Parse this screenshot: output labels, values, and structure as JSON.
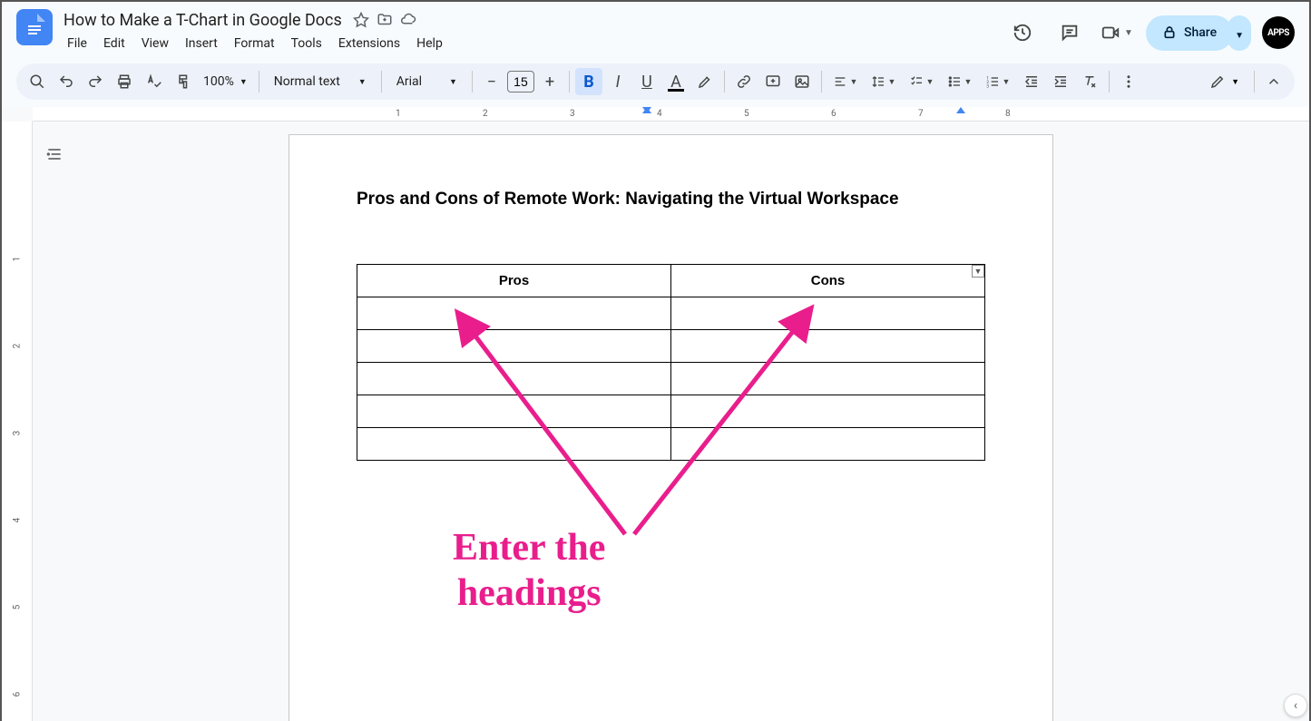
{
  "header": {
    "doc_title": "How to Make a T-Chart in Google Docs",
    "menu": [
      "File",
      "Edit",
      "View",
      "Insert",
      "Format",
      "Tools",
      "Extensions",
      "Help"
    ],
    "share_label": "Share",
    "avatar_text": "APPS"
  },
  "toolbar": {
    "zoom": "100%",
    "paragraph_style": "Normal text",
    "font": "Arial",
    "font_size": "15"
  },
  "ruler": {
    "h_numbers": [
      1,
      2,
      3,
      4,
      5,
      6,
      7,
      8
    ],
    "v_numbers": [
      1,
      2,
      3,
      4,
      5,
      6
    ]
  },
  "document": {
    "heading": "Pros and Cons of Remote Work: Navigating the Virtual Workspace",
    "table": {
      "headers": [
        "Pros",
        "Cons"
      ],
      "rows": 5
    }
  },
  "annotation": {
    "line1": "Enter the",
    "line2": "headings"
  }
}
